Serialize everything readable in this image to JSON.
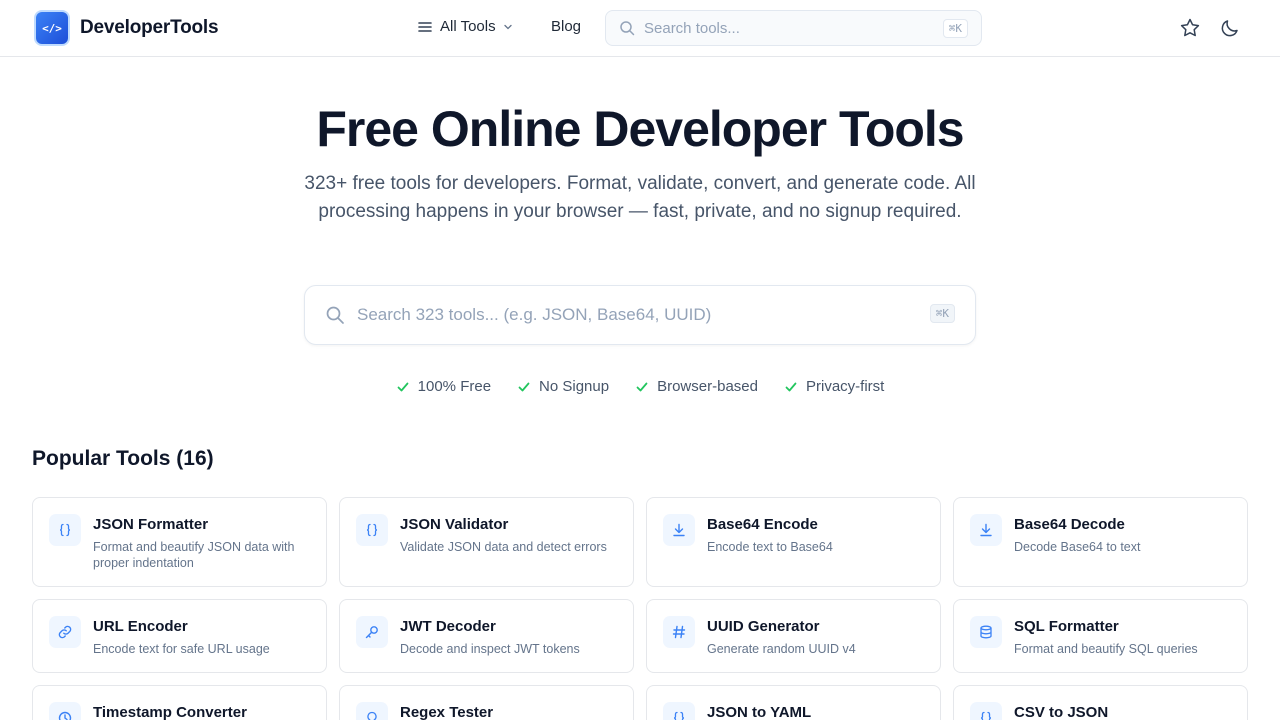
{
  "header": {
    "logo_text": "DeveloperTools",
    "logo_badge": "</>",
    "nav_all_tools": "All Tools",
    "nav_blog": "Blog",
    "search_placeholder": "Search tools...",
    "search_shortcut": "⌘K"
  },
  "hero": {
    "title": "Free Online Developer Tools",
    "subtitle": "323+ free tools for developers. Format, validate, convert, and generate code. All processing happens in your browser — fast, private, and no signup required.",
    "search_placeholder": "Search 323 tools... (e.g. JSON, Base64, UUID)",
    "search_shortcut": "⌘K",
    "features": [
      "100% Free",
      "No Signup",
      "Browser-based",
      "Privacy-first"
    ]
  },
  "popular": {
    "title": "Popular Tools (16)",
    "tools": [
      {
        "title": "JSON Formatter",
        "desc": "Format and beautify JSON data with proper indentation",
        "icon": "braces-icon"
      },
      {
        "title": "JSON Validator",
        "desc": "Validate JSON data and detect errors",
        "icon": "braces-icon"
      },
      {
        "title": "Base64 Encode",
        "desc": "Encode text to Base64",
        "icon": "download-icon"
      },
      {
        "title": "Base64 Decode",
        "desc": "Decode Base64 to text",
        "icon": "download-icon"
      },
      {
        "title": "URL Encoder",
        "desc": "Encode text for safe URL usage",
        "icon": "link-icon"
      },
      {
        "title": "JWT Decoder",
        "desc": "Decode and inspect JWT tokens",
        "icon": "key-icon"
      },
      {
        "title": "UUID Generator",
        "desc": "Generate random UUID v4",
        "icon": "hash-icon"
      },
      {
        "title": "SQL Formatter",
        "desc": "Format and beautify SQL queries",
        "icon": "database-icon"
      },
      {
        "title": "Timestamp Converter",
        "desc": "",
        "icon": "clock-icon"
      },
      {
        "title": "Regex Tester",
        "desc": "",
        "icon": "bulb-icon"
      },
      {
        "title": "JSON to YAML",
        "desc": "",
        "icon": "braces-icon"
      },
      {
        "title": "CSV to JSON",
        "desc": "",
        "icon": "braces-icon"
      }
    ]
  },
  "colors": {
    "accent": "#3b82f6",
    "check": "#22c55e",
    "text": "#0f172a",
    "muted": "#64748b"
  }
}
